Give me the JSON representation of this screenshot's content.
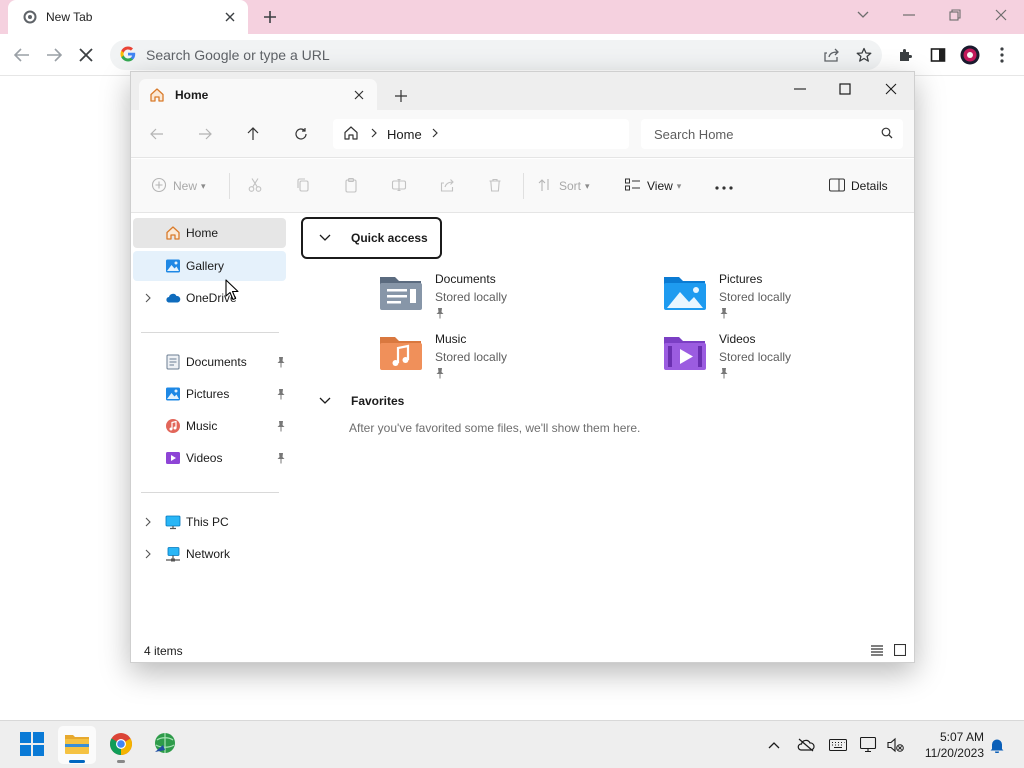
{
  "browser": {
    "tab_title": "New Tab",
    "omnibox_placeholder": "Search Google or type a URL"
  },
  "explorer": {
    "tab_title": "Home",
    "address": {
      "segments": [
        "Home"
      ]
    },
    "search_placeholder": "Search Home",
    "commands": {
      "new": "New",
      "sort": "Sort",
      "view": "View",
      "details": "Details"
    },
    "sidebar": {
      "home": "Home",
      "gallery": "Gallery",
      "onedrive": "OneDrive",
      "documents": "Documents",
      "pictures": "Pictures",
      "music": "Music",
      "videos": "Videos",
      "this_pc": "This PC",
      "network": "Network"
    },
    "quick_access": {
      "header": "Quick access",
      "items": [
        {
          "name": "Documents",
          "status": "Stored locally",
          "icon": "documents-folder-icon"
        },
        {
          "name": "Pictures",
          "status": "Stored locally",
          "icon": "pictures-folder-icon"
        },
        {
          "name": "Music",
          "status": "Stored locally",
          "icon": "music-folder-icon"
        },
        {
          "name": "Videos",
          "status": "Stored locally",
          "icon": "videos-folder-icon"
        }
      ]
    },
    "favorites": {
      "header": "Favorites",
      "empty_text": "After you've favorited some files, we'll show them here."
    },
    "status": {
      "item_count": "4 items"
    }
  },
  "taskbar": {
    "time": "5:07 AM",
    "date": "11/20/2023"
  },
  "colors": {
    "chrome_tabstrip": "#f5d1df",
    "accent_blue": "#0067c0",
    "folder_yellow": "#f5c242"
  }
}
